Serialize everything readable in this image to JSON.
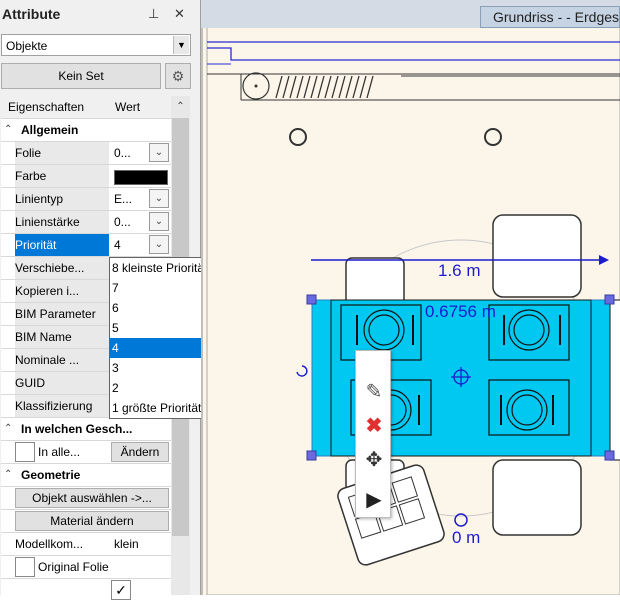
{
  "panel": {
    "title": "Attribute",
    "pin_glyph": "⊥",
    "close_glyph": "✕",
    "object_combo": "Objekte",
    "set_button": "Kein Set",
    "gear_glyph": "⚙"
  },
  "grid": {
    "col_properties": "Eigenschaften",
    "col_value": "Wert",
    "sections": {
      "general": "Allgemein",
      "floors": "In welchen Gesch...",
      "geometry": "Geometrie"
    },
    "rows": {
      "folie": {
        "label": "Folie",
        "value": "0..."
      },
      "farbe": {
        "label": "Farbe"
      },
      "linientyp": {
        "label": "Linientyp",
        "value": "E..."
      },
      "linienstaerke": {
        "label": "Linienstärke",
        "value": "0..."
      },
      "prioritaet": {
        "label": "Priorität",
        "value": "4"
      },
      "verschieben": {
        "label": "Verschiebe..."
      },
      "kopieren": {
        "label": "Kopieren i..."
      },
      "bim_parameter": {
        "label": "BIM Parameter"
      },
      "bim_name": {
        "label": "BIM Name"
      },
      "nominale": {
        "label": "Nominale ..."
      },
      "guid": {
        "label": "GUID"
      },
      "klassifizierung": {
        "label": "Klassifizierung"
      },
      "in_alle": {
        "label": "In alle...",
        "button": "Ändern"
      },
      "objekt_auswaehlen": {
        "button": "Objekt auswählen ->..."
      },
      "material": {
        "button": "Material ändern"
      },
      "modellkom": {
        "label": "Modellkom...",
        "value": "klein"
      },
      "original_folie": {
        "label": "Original Folie"
      }
    }
  },
  "priority_dropdown": {
    "options": [
      "8 kleinste Priorität",
      "7",
      "6",
      "5",
      "4",
      "3",
      "2",
      "1 größte Priorität"
    ],
    "selected_index": 4
  },
  "drawing": {
    "tab_title": "Grundriss -  - Erdgeschoss",
    "dim_width": "1.6 m",
    "dim_depth": "0.6756 m",
    "dim_rotation": "0 m",
    "colors": {
      "selection": "#00c8f0",
      "dimension": "#1c1ccc",
      "handle": "#6a6ae0",
      "background": "#fcf6ea"
    }
  },
  "context_toolbar": {
    "icons": [
      "pencil-icon",
      "delete-icon",
      "move-icon",
      "play-icon"
    ]
  }
}
